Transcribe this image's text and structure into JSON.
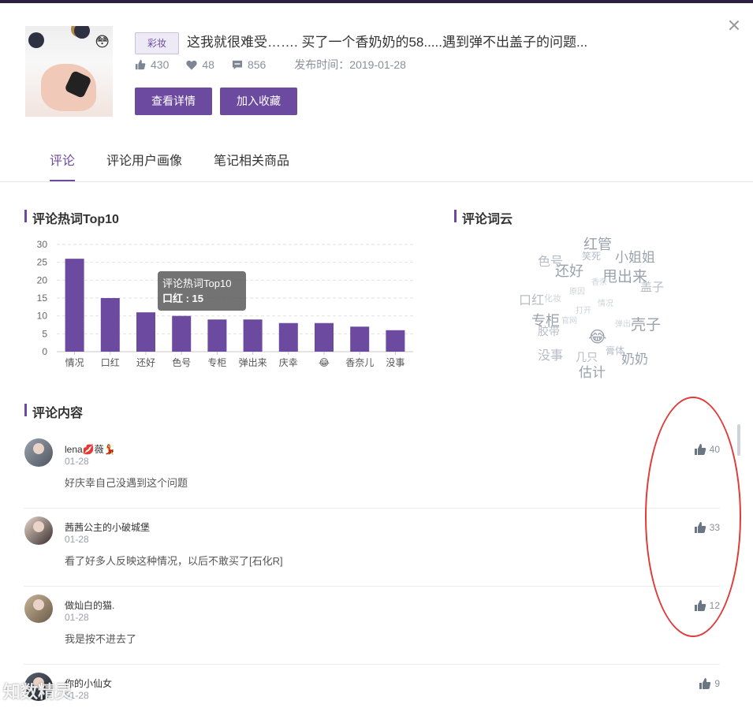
{
  "note": {
    "tag": "彩妆",
    "title": "这我就很难受……. 买了一个香奶奶的58.....遇到弹不出盖子的问题...",
    "likes": "430",
    "favorites": "48",
    "comments": "856",
    "publish_label": "发布时间：",
    "publish_date": "2019-01-28",
    "thumb_emoji": "😳",
    "view_button": "查看详情",
    "collect_button": "加入收藏"
  },
  "tabs": [
    "评论",
    "评论用户画像",
    "笔记相关商品"
  ],
  "sections": {
    "hotwords": "评论热词Top10",
    "cloud": "评论词云",
    "content": "评论内容"
  },
  "chart_data": {
    "type": "bar",
    "title": "评论热词Top10",
    "categories": [
      "情况",
      "口红",
      "还好",
      "色号",
      "专柜",
      "弹出来",
      "庆幸",
      "😂",
      "香奈儿",
      "没事"
    ],
    "values": [
      26,
      15,
      11,
      10,
      9,
      9,
      8,
      8,
      7,
      6
    ],
    "ylim": [
      0,
      30
    ],
    "yticks": [
      0,
      5,
      10,
      15,
      20,
      25,
      30
    ],
    "grid": true,
    "bar_color": "#6c4aa0",
    "tooltip": {
      "title": "评论热词Top10",
      "label": "口红 : 15"
    }
  },
  "wordcloud": [
    {
      "w": "红管"
    },
    {
      "w": "色号"
    },
    {
      "w": "笑死"
    },
    {
      "w": "小姐姐"
    },
    {
      "w": "还好"
    },
    {
      "w": "甩出来"
    },
    {
      "w": "盖子"
    },
    {
      "w": "口红"
    },
    {
      "w": "专柜"
    },
    {
      "w": "壳子"
    },
    {
      "w": "胶带"
    },
    {
      "w": "没事"
    },
    {
      "w": "几只"
    },
    {
      "w": "膏体"
    },
    {
      "w": "奶奶"
    },
    {
      "w": "估计"
    },
    {
      "w": "😂"
    },
    {
      "w": "化妆"
    },
    {
      "w": "弹出"
    },
    {
      "w": "官网"
    },
    {
      "w": "原因"
    },
    {
      "w": "打开"
    },
    {
      "w": "情况"
    },
    {
      "w": "香奈"
    }
  ],
  "comment_list": [
    {
      "name": "lena💋薇💃",
      "time": "01-28",
      "text": "好庆幸自己没遇到这个问题",
      "likes": "40"
    },
    {
      "name": "茜茜公主的小破城堡",
      "time": "01-28",
      "text": "看了好多人反映这种情况，以后不敢买了[石化R]",
      "likes": "33"
    },
    {
      "name": "做灿白的猫.",
      "time": "01-28",
      "text": "我是按不进去了",
      "likes": "12"
    },
    {
      "name": "你的小仙女",
      "time": "01-28",
      "text": "",
      "likes": "9"
    }
  ],
  "watermark": "知数精灵",
  "colors": {
    "accent": "#6c4aa0",
    "annotation": "#e03b3b"
  }
}
